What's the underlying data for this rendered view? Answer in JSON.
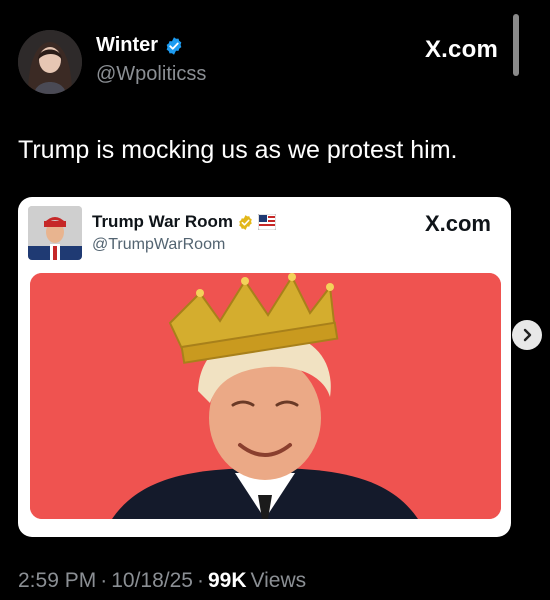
{
  "tweet": {
    "display_name": "Winter",
    "handle": "@Wpoliticss",
    "brand": "X.com",
    "text": "Trump is mocking us as we protest him."
  },
  "quoted": {
    "display_name": "Trump War Room",
    "handle": "@TrumpWarRoom",
    "brand": "X.com",
    "media_background": "#ef5350"
  },
  "footer": {
    "time": "2:59 PM",
    "sep1": "·",
    "date": "10/18/25",
    "sep2": "·",
    "views_count": "99K",
    "views_label": "Views"
  },
  "colors": {
    "verified_blue": "#1d9bf0",
    "verified_gold": "#e2b719",
    "muted_text": "#8b8f94"
  }
}
